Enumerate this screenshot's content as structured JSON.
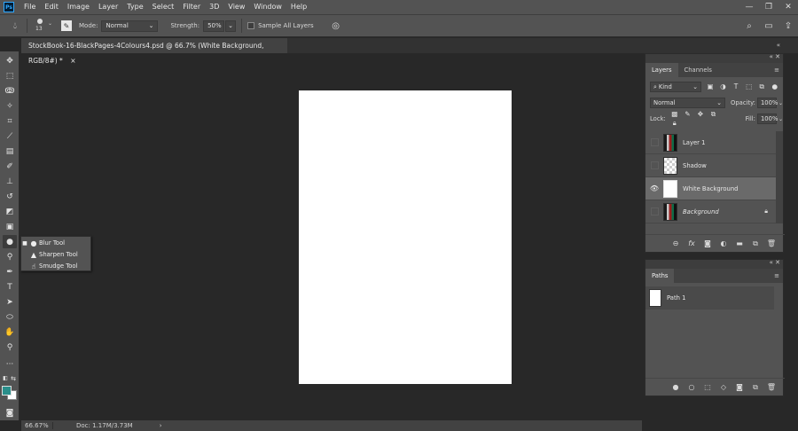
{
  "app": {
    "logo": "Ps",
    "menu": [
      "File",
      "Edit",
      "Image",
      "Layer",
      "Type",
      "Select",
      "Filter",
      "3D",
      "View",
      "Window",
      "Help"
    ],
    "window_controls": [
      "—",
      "❐",
      "✕"
    ]
  },
  "options_bar": {
    "brush_size": "13",
    "mode_label": "Mode:",
    "mode_value": "Normal",
    "strength_label": "Strength:",
    "strength_value": "50%",
    "sample_all_layers_label": "Sample All Layers"
  },
  "document": {
    "tab_title": "StockBook-16-BlackPages-4Colours4.psd @ 66.7% (White Background, RGB/8#) *",
    "tab_close": "×",
    "canvas_color": "#ffffff"
  },
  "toolbar": {
    "foreground_color": "#2a8e8a",
    "background_color": "#ffffff"
  },
  "tool_flyout": {
    "items": [
      {
        "label": "Blur Tool",
        "icon": "blur-drop-icon",
        "active": true
      },
      {
        "label": "Sharpen Tool",
        "icon": "sharpen-triangle-icon",
        "active": false
      },
      {
        "label": "Smudge Tool",
        "icon": "smudge-finger-icon",
        "active": false
      }
    ]
  },
  "status_bar": {
    "zoom": "66.67%",
    "doc_info": "Doc: 1.17M/3.73M",
    "arrow": "›"
  },
  "layers_panel": {
    "tabs": [
      "Layers",
      "Channels"
    ],
    "filter_kind": "Kind",
    "blend_mode": "Normal",
    "opacity_label": "Opacity:",
    "opacity_value": "100%",
    "lock_label": "Lock:",
    "fill_label": "Fill:",
    "fill_value": "100%",
    "layers": [
      {
        "name": "Layer 1",
        "visible": false,
        "thumb": "photo",
        "selected": false,
        "italic": false,
        "locked": false
      },
      {
        "name": "Shadow",
        "visible": false,
        "thumb": "checker",
        "selected": false,
        "italic": false,
        "locked": false
      },
      {
        "name": "White Background",
        "visible": true,
        "thumb": "white",
        "selected": true,
        "italic": false,
        "locked": false
      },
      {
        "name": "Background",
        "visible": false,
        "thumb": "photo",
        "selected": false,
        "italic": true,
        "locked": true
      }
    ]
  },
  "paths_panel": {
    "tab": "Paths",
    "paths": [
      {
        "name": "Path 1"
      }
    ]
  }
}
